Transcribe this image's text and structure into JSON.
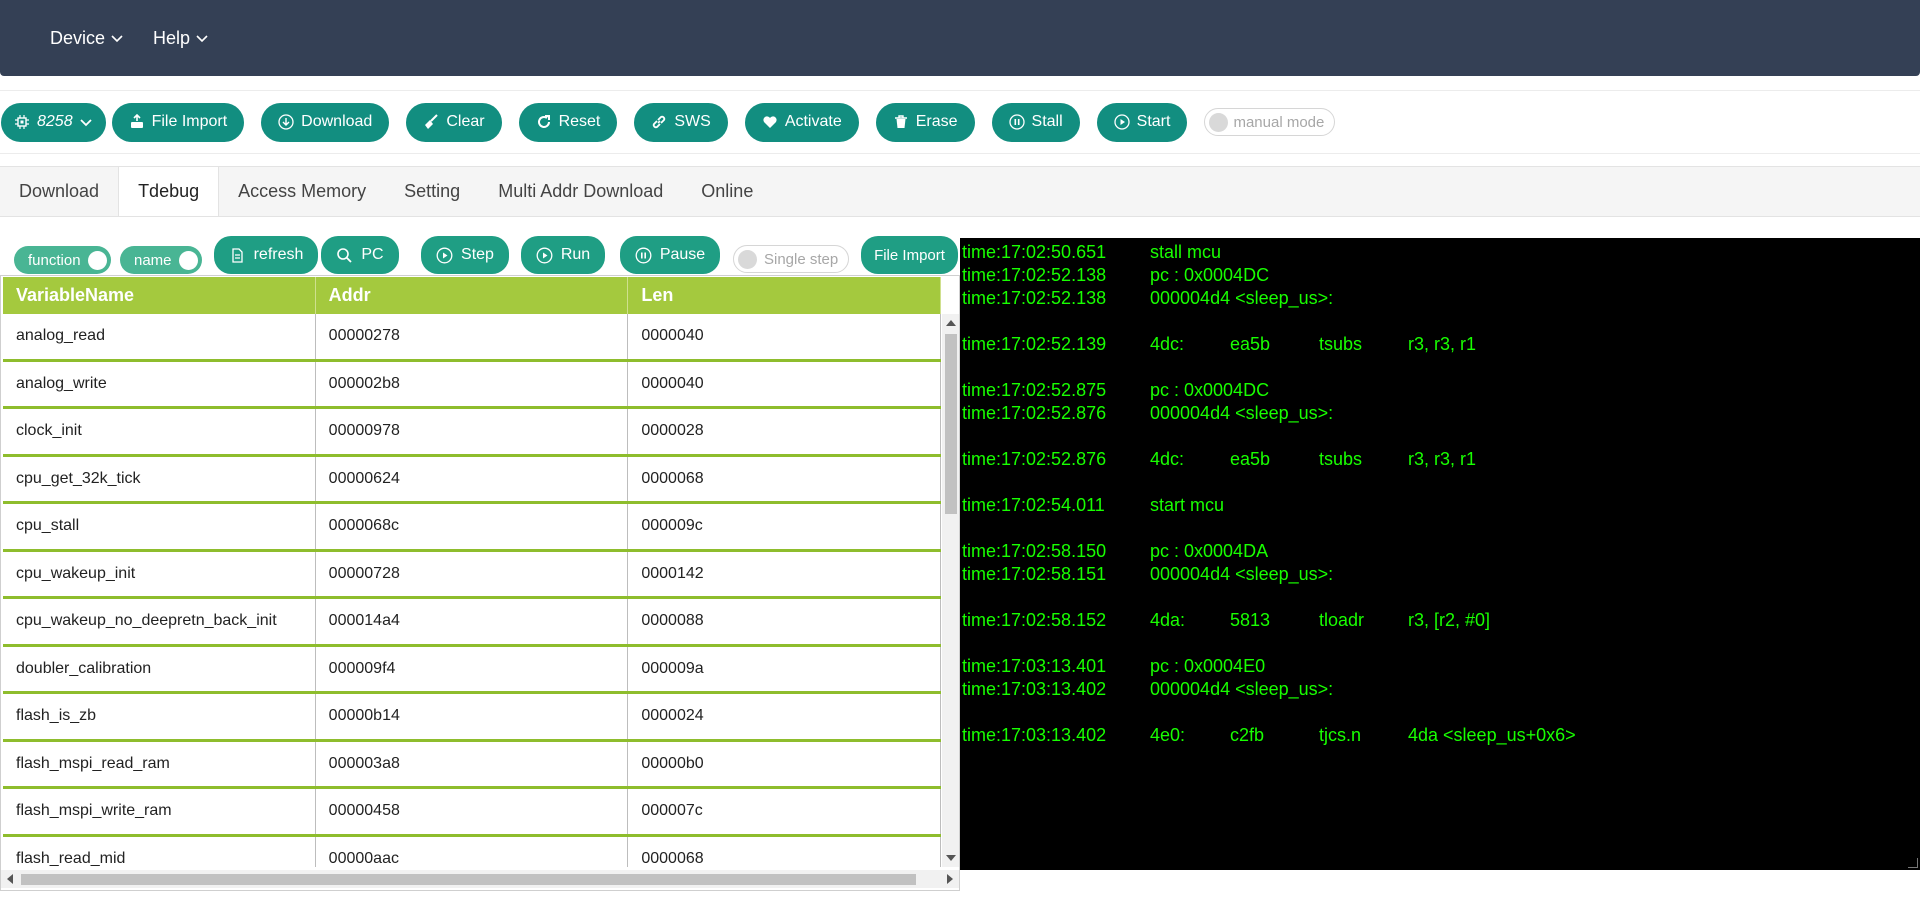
{
  "nav": {
    "menus": [
      {
        "label": "Device"
      },
      {
        "label": "Help"
      }
    ]
  },
  "toolbar": {
    "chip_label": "8258",
    "buttons": [
      {
        "label": "File Import",
        "icon": "file-import-icon"
      },
      {
        "label": "Download",
        "icon": "download-icon"
      },
      {
        "label": "Clear",
        "icon": "broom-icon"
      },
      {
        "label": "Reset",
        "icon": "reset-icon"
      },
      {
        "label": "SWS",
        "icon": "link-icon"
      },
      {
        "label": "Activate",
        "icon": "heart-icon"
      },
      {
        "label": "Erase",
        "icon": "trash-icon"
      },
      {
        "label": "Stall",
        "icon": "pause-circle-icon"
      },
      {
        "label": "Start",
        "icon": "play-circle-icon"
      }
    ],
    "manual_mode_label": "manual mode"
  },
  "tabs": [
    {
      "label": "Download",
      "active": false
    },
    {
      "label": "Tdebug",
      "active": true
    },
    {
      "label": "Access Memory",
      "active": false
    },
    {
      "label": "Setting",
      "active": false
    },
    {
      "label": "Multi Addr Download",
      "active": false
    },
    {
      "label": "Online",
      "active": false
    }
  ],
  "debug": {
    "function_toggle": "function",
    "name_toggle": "name",
    "refresh_label": "refresh",
    "pc_label": "PC",
    "step_label": "Step",
    "run_label": "Run",
    "pause_label": "Pause",
    "single_step_label": "Single step",
    "file_import_label": "File Import"
  },
  "table": {
    "headers": [
      "VariableName",
      "Addr",
      "Len"
    ],
    "rows": [
      [
        "analog_read",
        "00000278",
        "0000040"
      ],
      [
        "analog_write",
        "000002b8",
        "0000040"
      ],
      [
        "clock_init",
        "00000978",
        "0000028"
      ],
      [
        "cpu_get_32k_tick",
        "00000624",
        "0000068"
      ],
      [
        "cpu_stall",
        "0000068c",
        "000009c"
      ],
      [
        "cpu_wakeup_init",
        "00000728",
        "0000142"
      ],
      [
        "cpu_wakeup_no_deepretn_back_init",
        "000014a4",
        "0000088"
      ],
      [
        "doubler_calibration",
        "000009f4",
        "000009a"
      ],
      [
        "flash_is_zb",
        "00000b14",
        "0000024"
      ],
      [
        "flash_mspi_read_ram",
        "000003a8",
        "00000b0"
      ],
      [
        "flash_mspi_write_ram",
        "00000458",
        "000007c"
      ],
      [
        "flash_read_mid",
        "00000aac",
        "0000068"
      ]
    ]
  },
  "console": {
    "lines": [
      {
        "time": "time:17:02:50.651",
        "msg": "stall mcu"
      },
      {
        "time": "time:17:02:52.138",
        "msg": "pc : 0x0004DC"
      },
      {
        "time": "time:17:02:52.138",
        "msg": "000004d4 <sleep_us>:"
      },
      {
        "time": "",
        "msg": ""
      },
      {
        "time": "time:17:02:52.139",
        "a": "4dc:",
        "b": "ea5b",
        "c": "tsubs",
        "d": "r3, r3, r1"
      },
      {
        "time": "",
        "msg": ""
      },
      {
        "time": "time:17:02:52.875",
        "msg": "pc : 0x0004DC"
      },
      {
        "time": "time:17:02:52.876",
        "msg": "000004d4 <sleep_us>:"
      },
      {
        "time": "",
        "msg": ""
      },
      {
        "time": "time:17:02:52.876",
        "a": "4dc:",
        "b": "ea5b",
        "c": "tsubs",
        "d": "r3, r3, r1"
      },
      {
        "time": "",
        "msg": ""
      },
      {
        "time": "time:17:02:54.011",
        "msg": "start mcu"
      },
      {
        "time": "",
        "msg": ""
      },
      {
        "time": "time:17:02:58.150",
        "msg": "pc : 0x0004DA"
      },
      {
        "time": "time:17:02:58.151",
        "msg": "000004d4 <sleep_us>:"
      },
      {
        "time": "",
        "msg": ""
      },
      {
        "time": "time:17:02:58.152",
        "a": "4da:",
        "b": "5813",
        "c": "tloadr",
        "d": "r3, [r2, #0]"
      },
      {
        "time": "",
        "msg": ""
      },
      {
        "time": "time:17:03:13.401",
        "msg": "pc : 0x0004E0"
      },
      {
        "time": "time:17:03:13.402",
        "msg": "000004d4 <sleep_us>:"
      },
      {
        "time": "",
        "msg": ""
      },
      {
        "time": "time:17:03:13.402",
        "a": "4e0:",
        "b": "c2fb",
        "c": "tjcs.n",
        "d": "4da <sleep_us+0x6>"
      }
    ]
  },
  "colors": {
    "nav_bg": "#344055",
    "button_teal": "#128e80",
    "table_header": "#a4c93e",
    "row_border": "#8ebd2d",
    "console_bg": "#000000",
    "console_text": "#18ff00"
  }
}
